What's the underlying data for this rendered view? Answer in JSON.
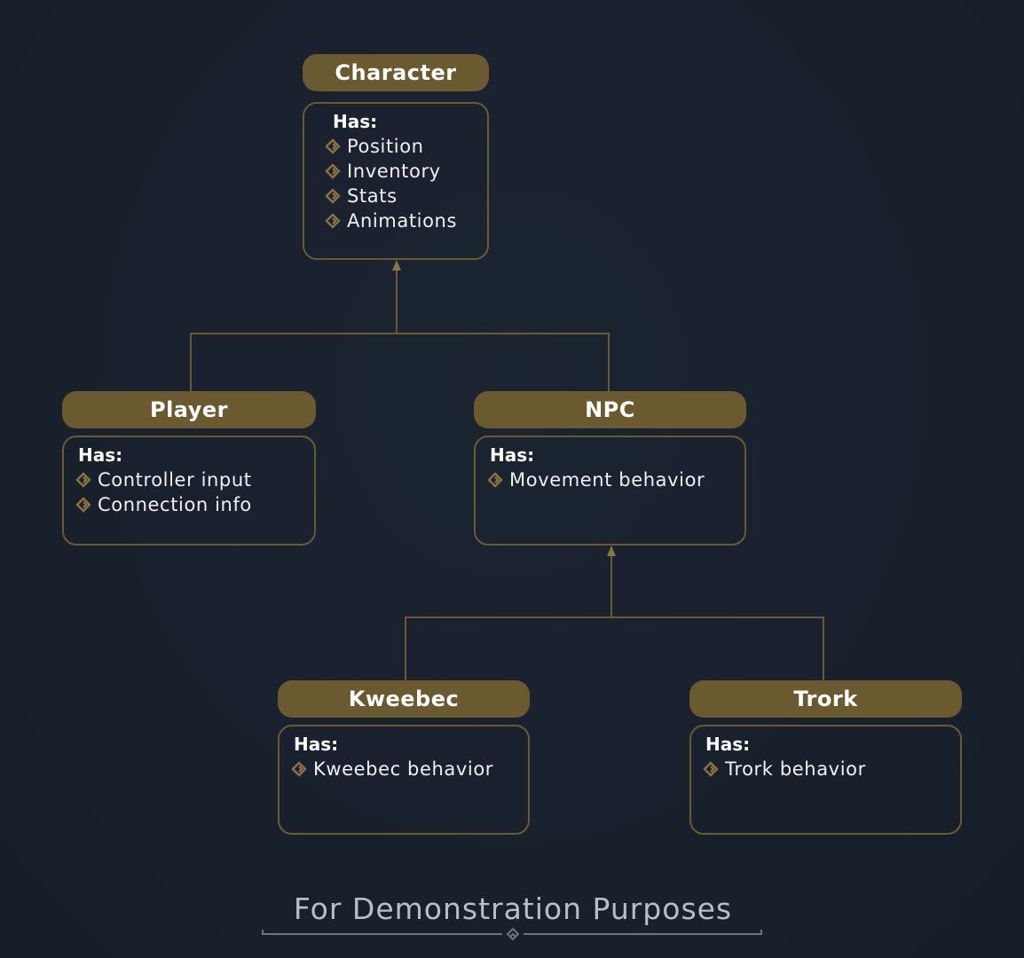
{
  "diagram": {
    "has_label": "Has:",
    "nodes": {
      "character": {
        "title": "Character",
        "properties": [
          "Position",
          "Inventory",
          "Stats",
          "Animations"
        ]
      },
      "player": {
        "title": "Player",
        "properties": [
          "Controller input",
          "Connection info"
        ]
      },
      "npc": {
        "title": "NPC",
        "properties": [
          "Movement behavior"
        ]
      },
      "kweebec": {
        "title": "Kweebec",
        "properties": [
          "Kweebec behavior"
        ]
      },
      "trork": {
        "title": "Trork",
        "properties": [
          "Trork behavior"
        ]
      }
    },
    "edges": [
      {
        "from": "player",
        "to": "character",
        "type": "inherits"
      },
      {
        "from": "npc",
        "to": "character",
        "type": "inherits"
      },
      {
        "from": "kweebec",
        "to": "npc",
        "type": "inherits"
      },
      {
        "from": "trork",
        "to": "npc",
        "type": "inherits"
      }
    ]
  },
  "footer": {
    "text": "For Demonstration Purposes"
  },
  "colors": {
    "accent": "#6b5a30",
    "background": "#18202c",
    "text": "#ffffff",
    "footer_text": "#b9bec6"
  },
  "icons": {
    "property_bullet": "diamond-bullet-icon",
    "footer_ornament": "diamond-ornament-icon"
  }
}
